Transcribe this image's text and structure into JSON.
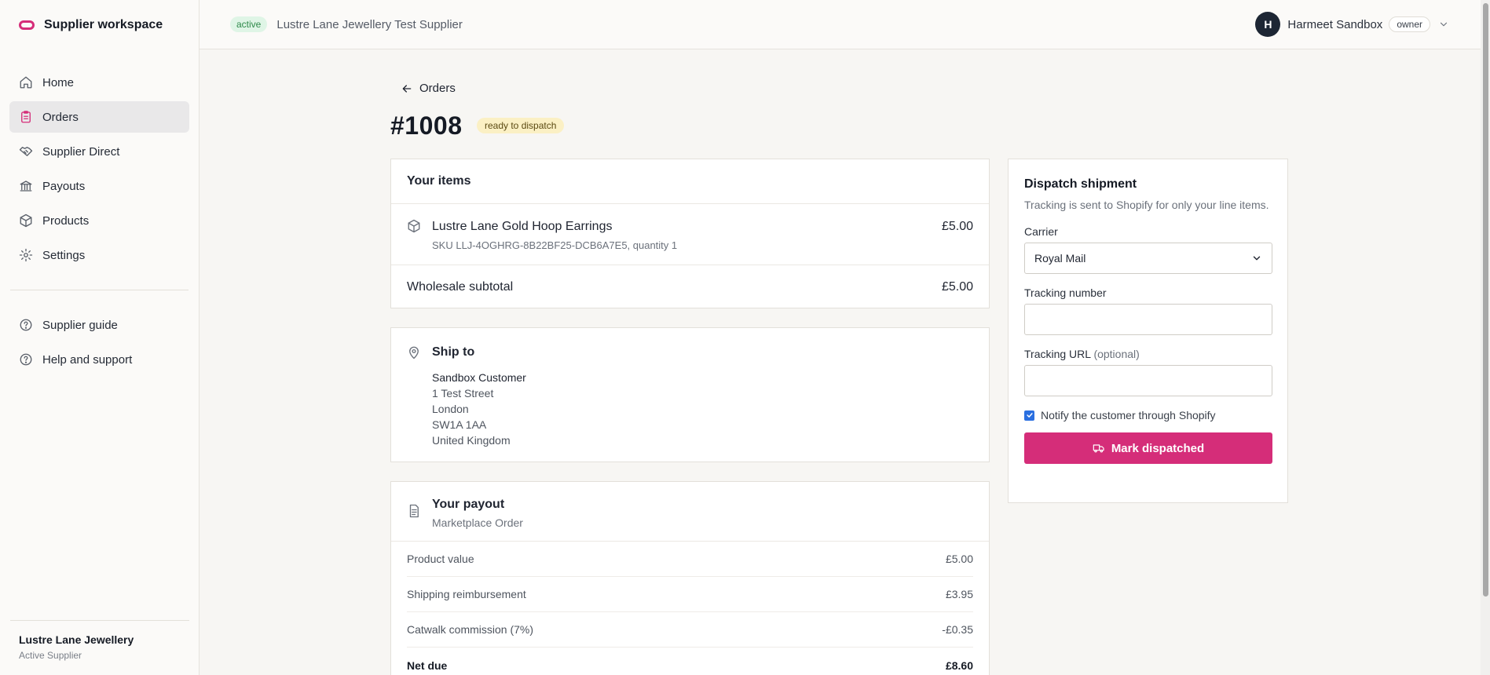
{
  "brand": {
    "name": "Supplier workspace"
  },
  "sidebar": {
    "items": [
      {
        "label": "Home",
        "icon": "home-icon"
      },
      {
        "label": "Orders",
        "icon": "clipboard-icon",
        "active": true
      },
      {
        "label": "Supplier Direct",
        "icon": "handshake-icon"
      },
      {
        "label": "Payouts",
        "icon": "bank-icon"
      },
      {
        "label": "Products",
        "icon": "box-icon"
      },
      {
        "label": "Settings",
        "icon": "gear-icon"
      }
    ],
    "secondary": [
      {
        "label": "Supplier guide",
        "icon": "help-circle-icon"
      },
      {
        "label": "Help and support",
        "icon": "help-circle-icon"
      }
    ],
    "footer": {
      "name": "Lustre Lane Jewellery",
      "role": "Active Supplier"
    }
  },
  "header": {
    "status": "active",
    "supplier": "Lustre Lane Jewellery Test Supplier",
    "user": {
      "initial": "H",
      "name": "Harmeet Sandbox",
      "role": "owner"
    }
  },
  "order": {
    "back_label": "Orders",
    "number": "#1008",
    "status": "ready to dispatch"
  },
  "items_card": {
    "title": "Your items",
    "items": [
      {
        "name": "Lustre Lane Gold Hoop Earrings",
        "sku": "SKU LLJ-4OGHRG-8B22BF25-DCB6A7E5, quantity 1",
        "price": "£5.00"
      }
    ],
    "subtotal_label": "Wholesale subtotal",
    "subtotal_value": "£5.00"
  },
  "ship_to": {
    "title": "Ship to",
    "lines": [
      "Sandbox Customer",
      "1 Test Street",
      "London",
      "SW1A 1AA",
      "United Kingdom"
    ]
  },
  "payout": {
    "title": "Your payout",
    "subtitle": "Marketplace Order",
    "rows": [
      {
        "label": "Product value",
        "value": "£5.00"
      },
      {
        "label": "Shipping reimbursement",
        "value": "£3.95"
      },
      {
        "label": "Catwalk commission (7%)",
        "value": "-£0.35"
      }
    ],
    "total": {
      "label": "Net due",
      "value": "£8.60"
    }
  },
  "dispatch": {
    "title": "Dispatch shipment",
    "description": "Tracking is sent to Shopify for only your line items.",
    "carrier_label": "Carrier",
    "carrier_value": "Royal Mail",
    "tracking_number_label": "Tracking number",
    "tracking_number_value": "",
    "tracking_url_label": "Tracking URL",
    "tracking_url_optional": "(optional)",
    "tracking_url_value": "",
    "notify_label": "Notify the customer through Shopify",
    "notify_checked": true,
    "button_label": "Mark dispatched"
  },
  "colors": {
    "accent": "#d52d79",
    "active_badge_bg": "#dff5e6",
    "status_badge_bg": "#fbf0c4"
  }
}
